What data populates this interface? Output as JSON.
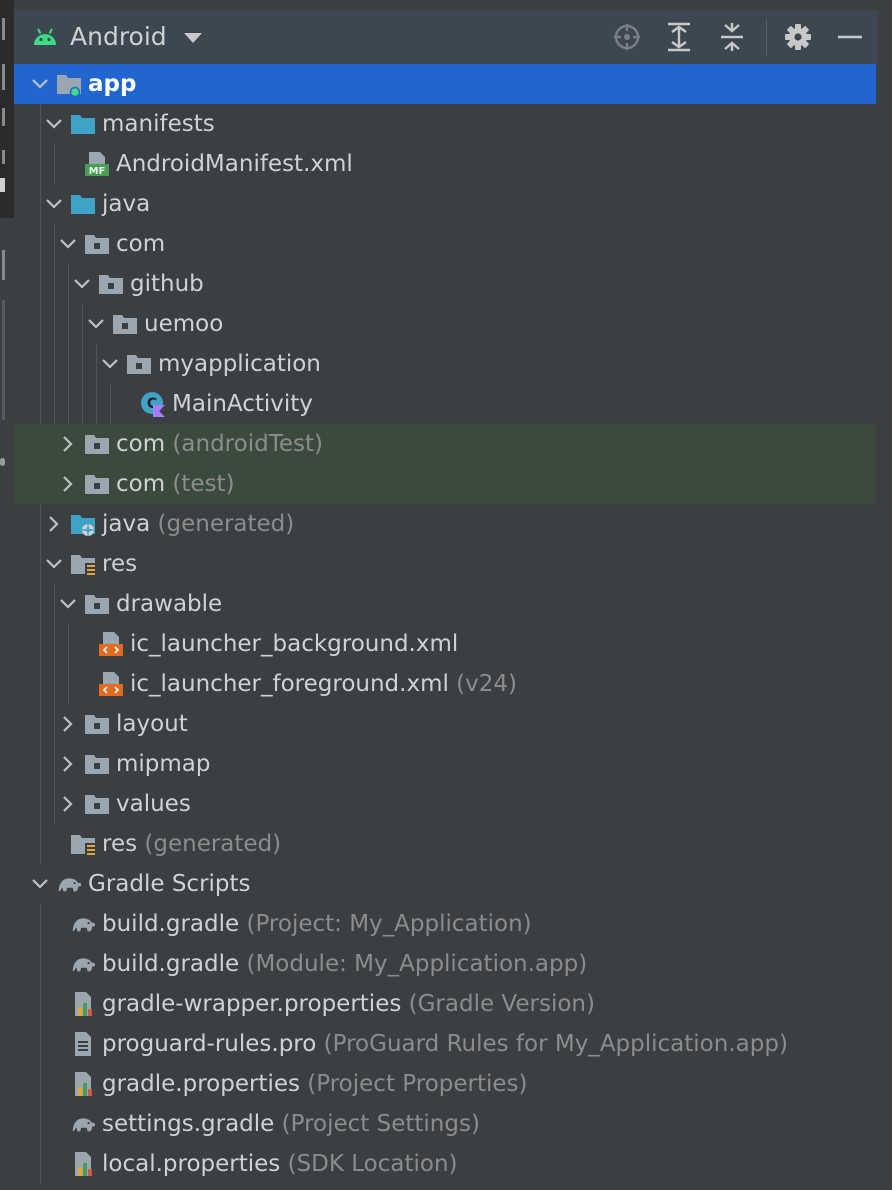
{
  "toolbar": {
    "view_mode": "Android",
    "buttons": [
      "locate-icon",
      "expand-all-icon",
      "collapse-all-icon",
      "gear-icon",
      "minimize-icon"
    ]
  },
  "tree": [
    {
      "label": "app",
      "sub": "",
      "icon": "module-folder",
      "depth": 0,
      "expanded": true,
      "bold": true,
      "selected": true
    },
    {
      "label": "manifests",
      "sub": "",
      "icon": "source-folder",
      "depth": 1,
      "expanded": true
    },
    {
      "label": "AndroidManifest.xml",
      "sub": "",
      "icon": "manifest-file",
      "depth": 2,
      "leaf": true
    },
    {
      "label": "java",
      "sub": "",
      "icon": "source-folder",
      "depth": 1,
      "expanded": true
    },
    {
      "label": "com",
      "sub": "",
      "icon": "package",
      "depth": 2,
      "expanded": true
    },
    {
      "label": "github",
      "sub": "",
      "icon": "package",
      "depth": 3,
      "expanded": true
    },
    {
      "label": "uemoo",
      "sub": "",
      "icon": "package",
      "depth": 4,
      "expanded": true
    },
    {
      "label": "myapplication",
      "sub": "",
      "icon": "package",
      "depth": 5,
      "expanded": true
    },
    {
      "label": "MainActivity",
      "sub": "",
      "icon": "kotlin-class",
      "depth": 6,
      "leaf": true
    },
    {
      "label": "com",
      "sub": "(androidTest)",
      "icon": "package",
      "depth": 2,
      "expanded": false,
      "scope": true
    },
    {
      "label": "com",
      "sub": "(test)",
      "icon": "package",
      "depth": 2,
      "expanded": false,
      "scope": true
    },
    {
      "label": "java",
      "sub": "(generated)",
      "icon": "generated-folder",
      "depth": 1,
      "expanded": false
    },
    {
      "label": "res",
      "sub": "",
      "icon": "res-folder",
      "depth": 1,
      "expanded": true
    },
    {
      "label": "drawable",
      "sub": "",
      "icon": "package",
      "depth": 2,
      "expanded": true
    },
    {
      "label": "ic_launcher_background.xml",
      "sub": "",
      "icon": "xml-file",
      "depth": 3,
      "leaf": true
    },
    {
      "label": "ic_launcher_foreground.xml",
      "sub": "(v24)",
      "icon": "xml-file",
      "depth": 3,
      "leaf": true
    },
    {
      "label": "layout",
      "sub": "",
      "icon": "package",
      "depth": 2,
      "expanded": false
    },
    {
      "label": "mipmap",
      "sub": "",
      "icon": "package",
      "depth": 2,
      "expanded": false
    },
    {
      "label": "values",
      "sub": "",
      "icon": "package",
      "depth": 2,
      "expanded": false
    },
    {
      "label": "res",
      "sub": "(generated)",
      "icon": "res-folder",
      "depth": 1,
      "leaf": true
    },
    {
      "label": "Gradle Scripts",
      "sub": "",
      "icon": "elephant",
      "depth": 0,
      "expanded": true
    },
    {
      "label": "build.gradle",
      "sub": "(Project: My_Application)",
      "icon": "elephant",
      "depth": 1,
      "leaf": true
    },
    {
      "label": "build.gradle",
      "sub": "(Module: My_Application.app)",
      "icon": "elephant",
      "depth": 1,
      "leaf": true
    },
    {
      "label": "gradle-wrapper.properties",
      "sub": "(Gradle Version)",
      "icon": "properties-file",
      "depth": 1,
      "leaf": true
    },
    {
      "label": "proguard-rules.pro",
      "sub": "(ProGuard Rules for My_Application.app)",
      "icon": "text-file",
      "depth": 1,
      "leaf": true
    },
    {
      "label": "gradle.properties",
      "sub": "(Project Properties)",
      "icon": "properties-file",
      "depth": 1,
      "leaf": true
    },
    {
      "label": "settings.gradle",
      "sub": "(Project Settings)",
      "icon": "elephant",
      "depth": 1,
      "leaf": true
    },
    {
      "label": "local.properties",
      "sub": "(SDK Location)",
      "icon": "properties-file",
      "depth": 1,
      "leaf": true
    }
  ],
  "colors": {
    "selection": "#2166cf",
    "test_scope": "#3c4a3e",
    "source_folder": "#3fa3c7",
    "package": "#9aa7b0",
    "android_green": "#3ddc84"
  }
}
